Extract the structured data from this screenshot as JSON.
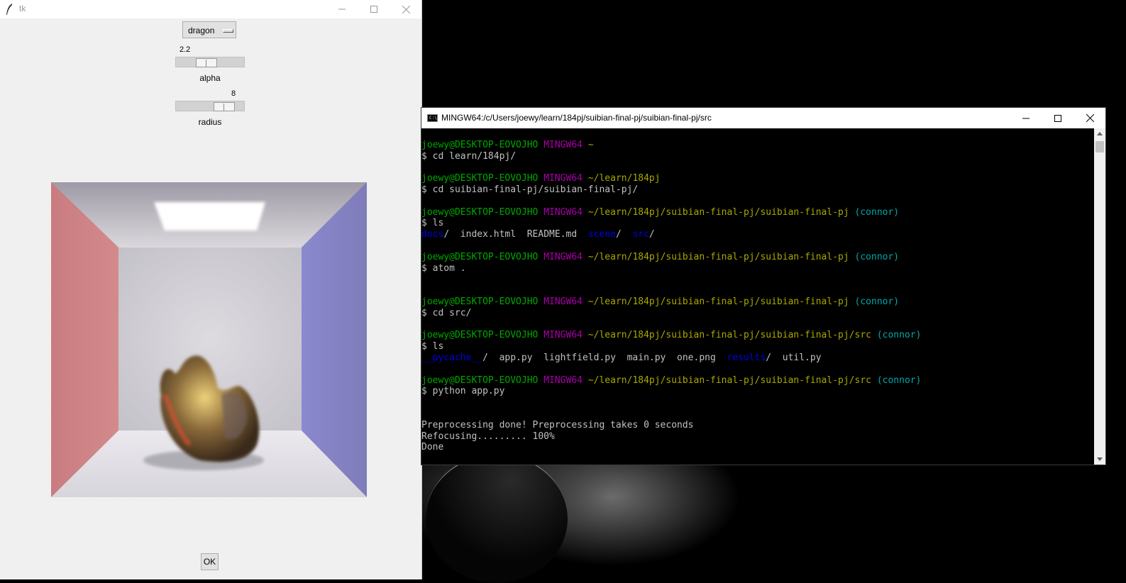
{
  "tk": {
    "title": "tk",
    "dropdown_value": "dragon",
    "alpha": {
      "value_text": "2.2",
      "label": "alpha",
      "level": 0.42
    },
    "radius": {
      "value_text": "8",
      "label": "radius",
      "level": 0.8
    },
    "ok_label": "OK"
  },
  "terminal": {
    "title": "MINGW64:/c/Users/joewy/learn/184pj/suibian-final-pj/suibian-final-pj/src",
    "colors": {
      "green": "#00a800",
      "magenta": "#a800a8",
      "yellow": "#a8a800",
      "cyan": "#00a8a8",
      "blue": "#0000e8"
    },
    "lines": [
      {
        "segments": []
      },
      {
        "segments": [
          {
            "t": "joewy@DESKTOP-EOVOJHO",
            "c": "c-green"
          },
          {
            "t": " "
          },
          {
            "t": "MINGW64",
            "c": "c-mag"
          },
          {
            "t": " "
          },
          {
            "t": "~",
            "c": "c-yel"
          }
        ]
      },
      {
        "segments": [
          {
            "t": "$ cd learn/184pj/"
          }
        ]
      },
      {
        "segments": []
      },
      {
        "segments": [
          {
            "t": "joewy@DESKTOP-EOVOJHO",
            "c": "c-green"
          },
          {
            "t": " "
          },
          {
            "t": "MINGW64",
            "c": "c-mag"
          },
          {
            "t": " "
          },
          {
            "t": "~/learn/184pj",
            "c": "c-yel"
          }
        ]
      },
      {
        "segments": [
          {
            "t": "$ cd suibian-final-pj/suibian-final-pj/"
          }
        ]
      },
      {
        "segments": []
      },
      {
        "segments": [
          {
            "t": "joewy@DESKTOP-EOVOJHO",
            "c": "c-green"
          },
          {
            "t": " "
          },
          {
            "t": "MINGW64",
            "c": "c-mag"
          },
          {
            "t": " "
          },
          {
            "t": "~/learn/184pj/suibian-final-pj/suibian-final-pj",
            "c": "c-yel"
          },
          {
            "t": " "
          },
          {
            "t": "(connor)",
            "c": "c-cyan"
          }
        ]
      },
      {
        "segments": [
          {
            "t": "$ ls"
          }
        ]
      },
      {
        "segments": [
          {
            "t": "docs",
            "c": "c-blue"
          },
          {
            "t": "/  index.html  README.md  "
          },
          {
            "t": "scene",
            "c": "c-blue"
          },
          {
            "t": "/  "
          },
          {
            "t": "src",
            "c": "c-blue"
          },
          {
            "t": "/"
          }
        ]
      },
      {
        "segments": []
      },
      {
        "segments": [
          {
            "t": "joewy@DESKTOP-EOVOJHO",
            "c": "c-green"
          },
          {
            "t": " "
          },
          {
            "t": "MINGW64",
            "c": "c-mag"
          },
          {
            "t": " "
          },
          {
            "t": "~/learn/184pj/suibian-final-pj/suibian-final-pj",
            "c": "c-yel"
          },
          {
            "t": " "
          },
          {
            "t": "(connor)",
            "c": "c-cyan"
          }
        ]
      },
      {
        "segments": [
          {
            "t": "$ atom ."
          }
        ]
      },
      {
        "segments": []
      },
      {
        "segments": []
      },
      {
        "segments": [
          {
            "t": "joewy@DESKTOP-EOVOJHO",
            "c": "c-green"
          },
          {
            "t": " "
          },
          {
            "t": "MINGW64",
            "c": "c-mag"
          },
          {
            "t": " "
          },
          {
            "t": "~/learn/184pj/suibian-final-pj/suibian-final-pj",
            "c": "c-yel"
          },
          {
            "t": " "
          },
          {
            "t": "(connor)",
            "c": "c-cyan"
          }
        ]
      },
      {
        "segments": [
          {
            "t": "$ cd src/"
          }
        ]
      },
      {
        "segments": []
      },
      {
        "segments": [
          {
            "t": "joewy@DESKTOP-EOVOJHO",
            "c": "c-green"
          },
          {
            "t": " "
          },
          {
            "t": "MINGW64",
            "c": "c-mag"
          },
          {
            "t": " "
          },
          {
            "t": "~/learn/184pj/suibian-final-pj/suibian-final-pj/src",
            "c": "c-yel"
          },
          {
            "t": " "
          },
          {
            "t": "(connor)",
            "c": "c-cyan"
          }
        ]
      },
      {
        "segments": [
          {
            "t": "$ ls"
          }
        ]
      },
      {
        "segments": [
          {
            "t": "__pycache__",
            "c": "c-blue"
          },
          {
            "t": "/  app.py  lightfield.py  main.py  one.png  "
          },
          {
            "t": "results",
            "c": "c-blue"
          },
          {
            "t": "/  util.py"
          }
        ]
      },
      {
        "segments": []
      },
      {
        "segments": [
          {
            "t": "joewy@DESKTOP-EOVOJHO",
            "c": "c-green"
          },
          {
            "t": " "
          },
          {
            "t": "MINGW64",
            "c": "c-mag"
          },
          {
            "t": " "
          },
          {
            "t": "~/learn/184pj/suibian-final-pj/suibian-final-pj/src",
            "c": "c-yel"
          },
          {
            "t": " "
          },
          {
            "t": "(connor)",
            "c": "c-cyan"
          }
        ]
      },
      {
        "segments": [
          {
            "t": "$ python app.py"
          }
        ]
      },
      {
        "segments": []
      },
      {
        "segments": []
      },
      {
        "segments": [
          {
            "t": "Preprocessing done! Preprocessing takes 0 seconds"
          }
        ]
      },
      {
        "segments": [
          {
            "t": "Refocusing......... 100%"
          }
        ]
      },
      {
        "segments": [
          {
            "t": "Done"
          }
        ]
      }
    ]
  }
}
